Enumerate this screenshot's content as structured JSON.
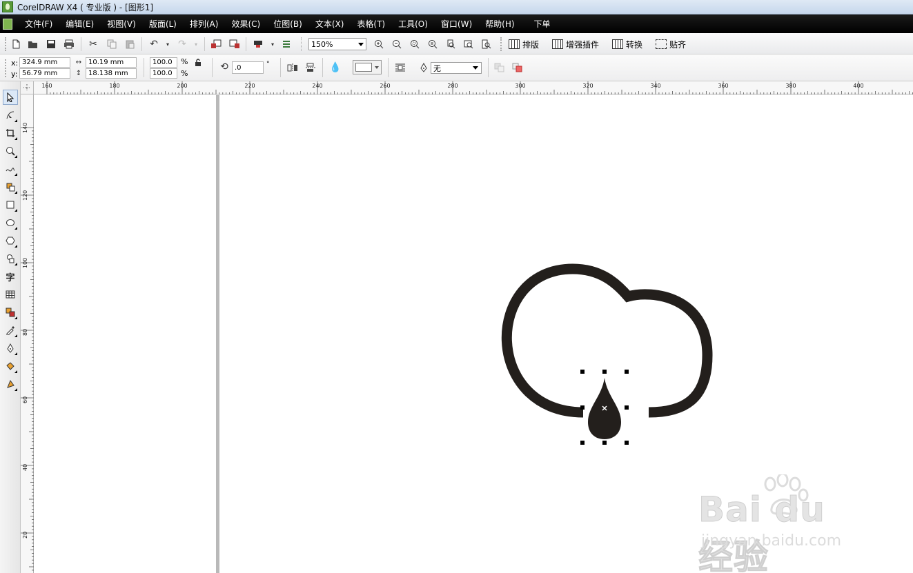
{
  "window": {
    "title": "CorelDRAW X4 ( 专业版 ) - [图形1]"
  },
  "menu": {
    "items": [
      "文件(F)",
      "编辑(E)",
      "视图(V)",
      "版面(L)",
      "排列(A)",
      "效果(C)",
      "位图(B)",
      "文本(X)",
      "表格(T)",
      "工具(O)",
      "窗口(W)",
      "帮助(H)",
      "下单"
    ]
  },
  "toolbar": {
    "zoom_value": "150%",
    "plugins": [
      "排版",
      "增强插件",
      "转换",
      "贴齐"
    ]
  },
  "property_bar": {
    "x_label": "x:",
    "x_value": "324.9 mm",
    "y_label": "y:",
    "y_value": "56.79 mm",
    "width_value": "10.19 mm",
    "height_value": "18.138 mm",
    "scale_x": "100.0",
    "scale_y": "100.0",
    "percent_symbol": "%",
    "rotation_value": ".0",
    "degree_symbol": "°",
    "outline_value": "无"
  },
  "rulers": {
    "horizontal_labels": [
      "160",
      "180",
      "200",
      "220",
      "240",
      "260",
      "280",
      "300",
      "320",
      "340",
      "360",
      "380",
      "400"
    ],
    "vertical_labels": [
      "140",
      "120",
      "100",
      "80",
      "60",
      "40",
      "20"
    ]
  },
  "toolbox": {
    "text_tool_glyph": "字"
  },
  "watermark": {
    "logo": "Bai du 经验",
    "url": "jingyan.baidu.com"
  },
  "colors": {
    "menubar": "#000000",
    "shape_fill": "#231f1c",
    "handle": "#000000"
  }
}
